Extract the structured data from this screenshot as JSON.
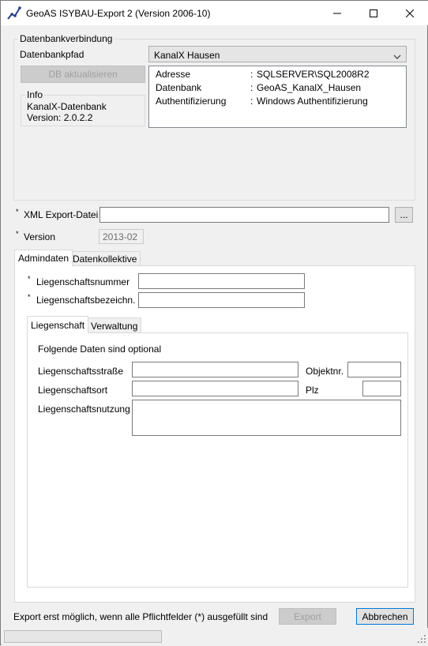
{
  "window": {
    "title": "GeoAS ISYBAU-Export 2 (Version 2006-10)"
  },
  "db_group": {
    "title": "Datenbankverbindung",
    "path_label": "Datenbankpfad",
    "path_value": "KanalX Hausen",
    "refresh_button": "DB aktualisieren",
    "info_title": "Info",
    "info_line1": "KanalX-Datenbank",
    "info_line2": "Version: 2.0.2.2",
    "details": [
      {
        "key": "Adresse",
        "sep": ":",
        "value": "SQLSERVER\\SQL2008R2"
      },
      {
        "key": "Datenbank",
        "sep": ":",
        "value": "GeoAS_KanalX_Hausen"
      },
      {
        "key": "Authentifizierung",
        "sep": ":",
        "value": "Windows Authentifizierung"
      }
    ]
  },
  "export": {
    "xml_label": "XML Export-Datei",
    "xml_value": "",
    "browse_button": "...",
    "version_label": "Version",
    "version_value": "2013-02",
    "required_mark": "*"
  },
  "tabs": {
    "outer": [
      "Admindaten",
      "Datenkollektive"
    ],
    "inner": [
      "Liegenschaft",
      "Verwaltung"
    ]
  },
  "admindaten": {
    "nummer_label": "Liegenschaftsnummer",
    "bezeichnung_label": "Liegenschaftsbezeichn.",
    "optional_note": "Folgende Daten sind optional",
    "strasse_label": "Liegenschaftsstraße",
    "objektnr_label": "Objektnr.",
    "ort_label": "Liegenschaftsort",
    "plz_label": "Plz",
    "nutzung_label": "Liegenschaftsnutzung"
  },
  "footer": {
    "hint": "Export erst möglich, wenn alle Pflichtfelder (*) ausgefüllt sind",
    "export_button": "Export",
    "cancel_button": "Abbrechen",
    "progress": 0
  },
  "icons": {
    "app": "geoas-app-icon",
    "minimize": "minimize-icon",
    "maximize": "maximize-icon",
    "close": "close-icon",
    "dropdown": "chevron-down-icon",
    "grip": "resize-grip-icon"
  }
}
